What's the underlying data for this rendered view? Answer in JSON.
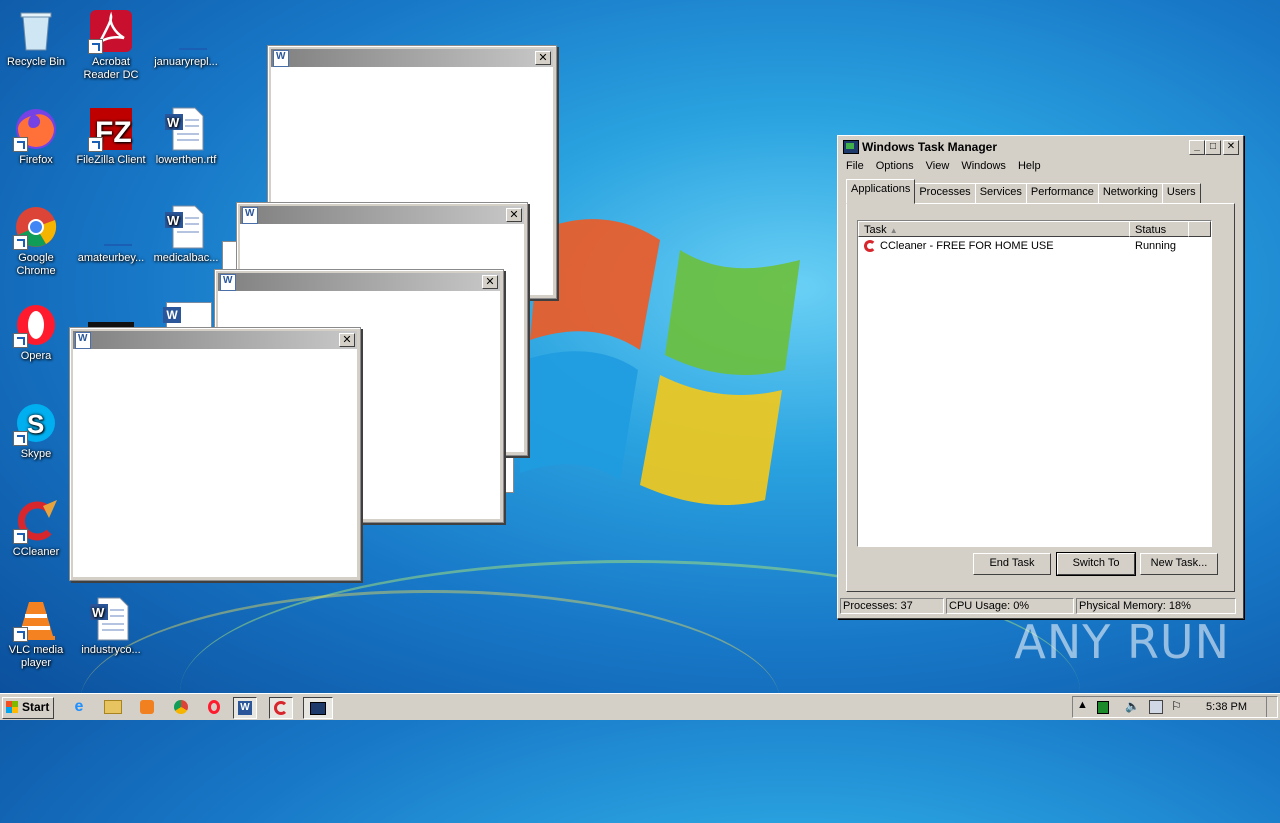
{
  "desktop": {
    "icons": [
      {
        "label": "Recycle Bin"
      },
      {
        "label": "Acrobat Reader DC"
      },
      {
        "label": "januaryrepl..."
      },
      {
        "label": "Firefox"
      },
      {
        "label": "FileZilla Client"
      },
      {
        "label": "lowerthen.rtf"
      },
      {
        "label": "Google Chrome"
      },
      {
        "label": "amateurbey..."
      },
      {
        "label": "medicalbac..."
      },
      {
        "label": "Opera"
      },
      {
        "label": "Skype"
      },
      {
        "label": "CCleaner"
      },
      {
        "label": "VLC media player"
      },
      {
        "label": "industryco..."
      }
    ]
  },
  "task_manager": {
    "title": "Windows Task Manager",
    "menu": [
      "File",
      "Options",
      "View",
      "Windows",
      "Help"
    ],
    "tabs": [
      "Applications",
      "Processes",
      "Services",
      "Performance",
      "Networking",
      "Users"
    ],
    "active_tab": "Applications",
    "columns": [
      "Task",
      "Status"
    ],
    "rows": [
      {
        "task": "CCleaner - FREE FOR HOME USE",
        "status": "Running"
      }
    ],
    "buttons": {
      "end_task": "End Task",
      "switch_to": "Switch To",
      "new_task": "New Task..."
    },
    "status": {
      "processes": "Processes: 37",
      "cpu": "CPU Usage: 0%",
      "memory": "Physical Memory: 18%"
    }
  },
  "watermark": "ANY RUN",
  "taskbar": {
    "start_label": "Start",
    "clock": "5:38 PM"
  },
  "colors": {
    "desktop_blue": "#1878c8",
    "classic_gray": "#d4d0c8",
    "titlebar_gray": "#808080"
  }
}
